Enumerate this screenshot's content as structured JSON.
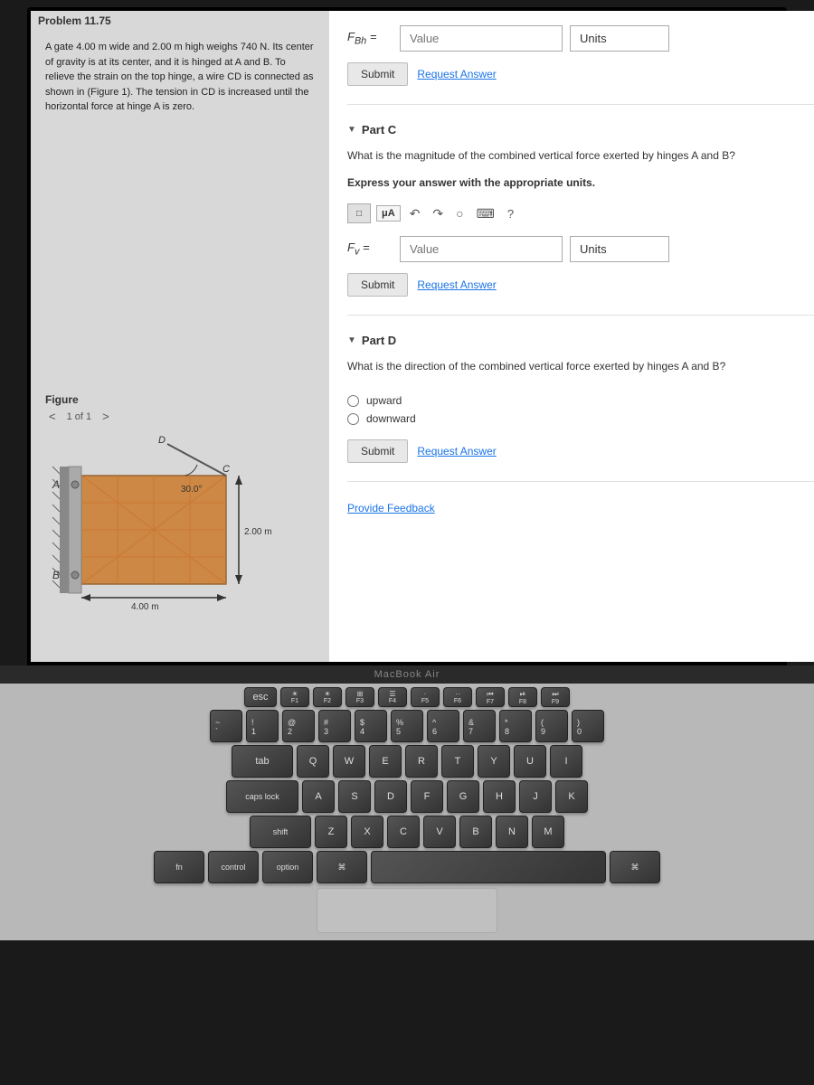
{
  "problem": {
    "title": "Problem 11.75",
    "description": "A gate 4.00 m wide and 2.00 m high weighs 740 N. Its center of gravity is at its center, and it is hinged at A and B. To relieve the strain on the top hinge, a wire CD is connected as shown in (Figure 1). The tension in CD is increased until the horizontal force at hinge A is zero.",
    "figure_label": "Figure",
    "figure_nav": "1 of 1",
    "dimensions": {
      "width": "4.00 m",
      "height": "2.00 m",
      "angle": "30.0°"
    },
    "points": {
      "A": "A",
      "B": "B",
      "C": "C",
      "D": "D"
    }
  },
  "top_input": {
    "label": "F",
    "subscript": "Bh",
    "equals": "=",
    "placeholder": "Value",
    "units_label": "Units"
  },
  "submit_row_top": {
    "submit_label": "Submit",
    "request_label": "Request Answer"
  },
  "part_c": {
    "header": "Part C",
    "question": "What is the magnitude of the combined vertical force exerted by hinges A and B?",
    "subtext": "Express your answer with the appropriate units.",
    "toolbar": {
      "box_icon": "□",
      "mu_a": "μA",
      "undo": "↶",
      "redo": "↷",
      "refresh": "○",
      "keyboard": "⌨",
      "help": "?"
    },
    "input": {
      "label": "F",
      "subscript": "v",
      "equals": "=",
      "placeholder": "Value",
      "units_label": "Units"
    },
    "submit_label": "Submit",
    "request_label": "Request Answer"
  },
  "part_d": {
    "header": "Part D",
    "question": "What is the direction of the combined vertical force exerted by hinges A and B?",
    "options": [
      {
        "id": "upward",
        "label": "upward"
      },
      {
        "id": "downward",
        "label": "downward"
      }
    ],
    "submit_label": "Submit",
    "request_label": "Request Answer"
  },
  "feedback": {
    "label": "Provide Feedback"
  },
  "macbook": {
    "label": "MacBook Air"
  },
  "keyboard": {
    "fn_row": [
      {
        "label": "esc",
        "wide": false
      },
      {
        "top": "",
        "bot": "F1",
        "icon": "☀"
      },
      {
        "top": "",
        "bot": "F2",
        "icon": "☀☀"
      },
      {
        "top": "",
        "bot": "F3",
        "icon": "⊞"
      },
      {
        "top": "",
        "bot": "F4",
        "icon": "⊠"
      },
      {
        "top": "",
        "bot": "F5",
        "icon": "·"
      },
      {
        "top": "",
        "bot": "F6",
        "icon": "··"
      },
      {
        "top": "",
        "bot": "F7",
        "icon": "◀◀"
      },
      {
        "top": "",
        "bot": "F8",
        "icon": "▶||"
      },
      {
        "top": "",
        "bot": "F9",
        "icon": "▶▶"
      }
    ],
    "row1": [
      "~`",
      "!1",
      "@2",
      "#3",
      "$4",
      "%5",
      "^6",
      "&7",
      "*8",
      "(9",
      ")0"
    ],
    "row2": [
      "Q",
      "W",
      "E",
      "R",
      "T",
      "Y",
      "U",
      "I"
    ],
    "row3": [
      "A",
      "S",
      "D",
      "F",
      "G",
      "H",
      "J",
      "K"
    ],
    "row4": [
      "Z",
      "X",
      "C",
      "V",
      "B",
      "N",
      "M"
    ]
  }
}
